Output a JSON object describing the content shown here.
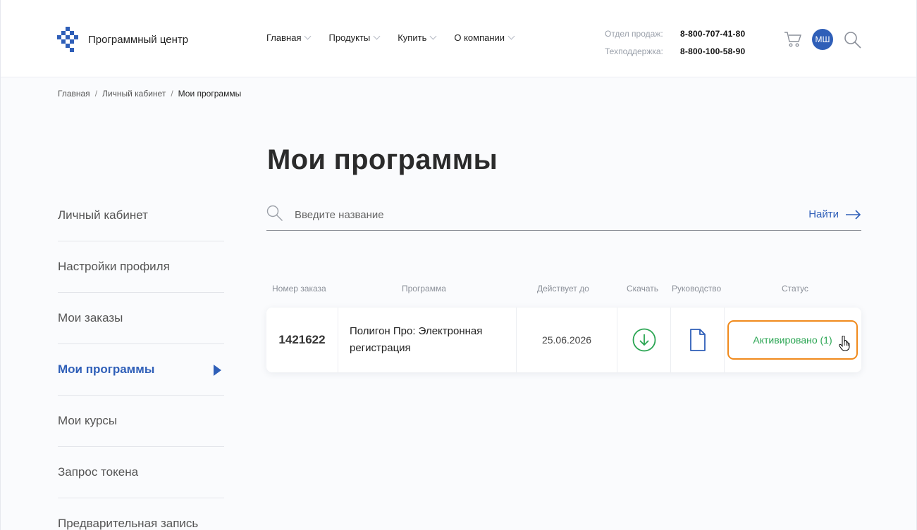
{
  "brand": {
    "name": "Программный центр"
  },
  "nav": [
    {
      "label": "Главная"
    },
    {
      "label": "Продукты"
    },
    {
      "label": "Купить"
    },
    {
      "label": "О компании"
    }
  ],
  "contacts": {
    "sales_label": "Отдел продаж:",
    "sales_phone": "8-800-707-41-80",
    "support_label": "Техподдержка:",
    "support_phone": "8-800-100-58-90"
  },
  "user": {
    "initials": "МШ"
  },
  "breadcrumb": {
    "home": "Главная",
    "cabinet": "Личный кабинет",
    "current": "Мои программы"
  },
  "page": {
    "title": "Мои программы"
  },
  "sidebar": {
    "items": [
      {
        "label": "Личный кабинет"
      },
      {
        "label": "Настройки профиля"
      },
      {
        "label": "Мои заказы"
      },
      {
        "label": "Мои программы",
        "active": true
      },
      {
        "label": "Мои курсы"
      },
      {
        "label": "Запрос токена"
      },
      {
        "label": "Предварительная запись"
      }
    ]
  },
  "search": {
    "placeholder": "Введите название",
    "value": "",
    "button": "Найти"
  },
  "table": {
    "headers": {
      "order": "Номер заказа",
      "program": "Программа",
      "valid_until": "Действует до",
      "download": "Скачать",
      "manual": "Руководство",
      "status": "Статус"
    },
    "rows": [
      {
        "order": "1421622",
        "program": "Полигон Про: Электронная регистрация",
        "valid_until": "25.06.2026",
        "status": "Активировано (1)"
      }
    ]
  },
  "colors": {
    "accent": "#2f5fb8",
    "status_green": "#2aa552",
    "highlight": "#f08a1c"
  }
}
